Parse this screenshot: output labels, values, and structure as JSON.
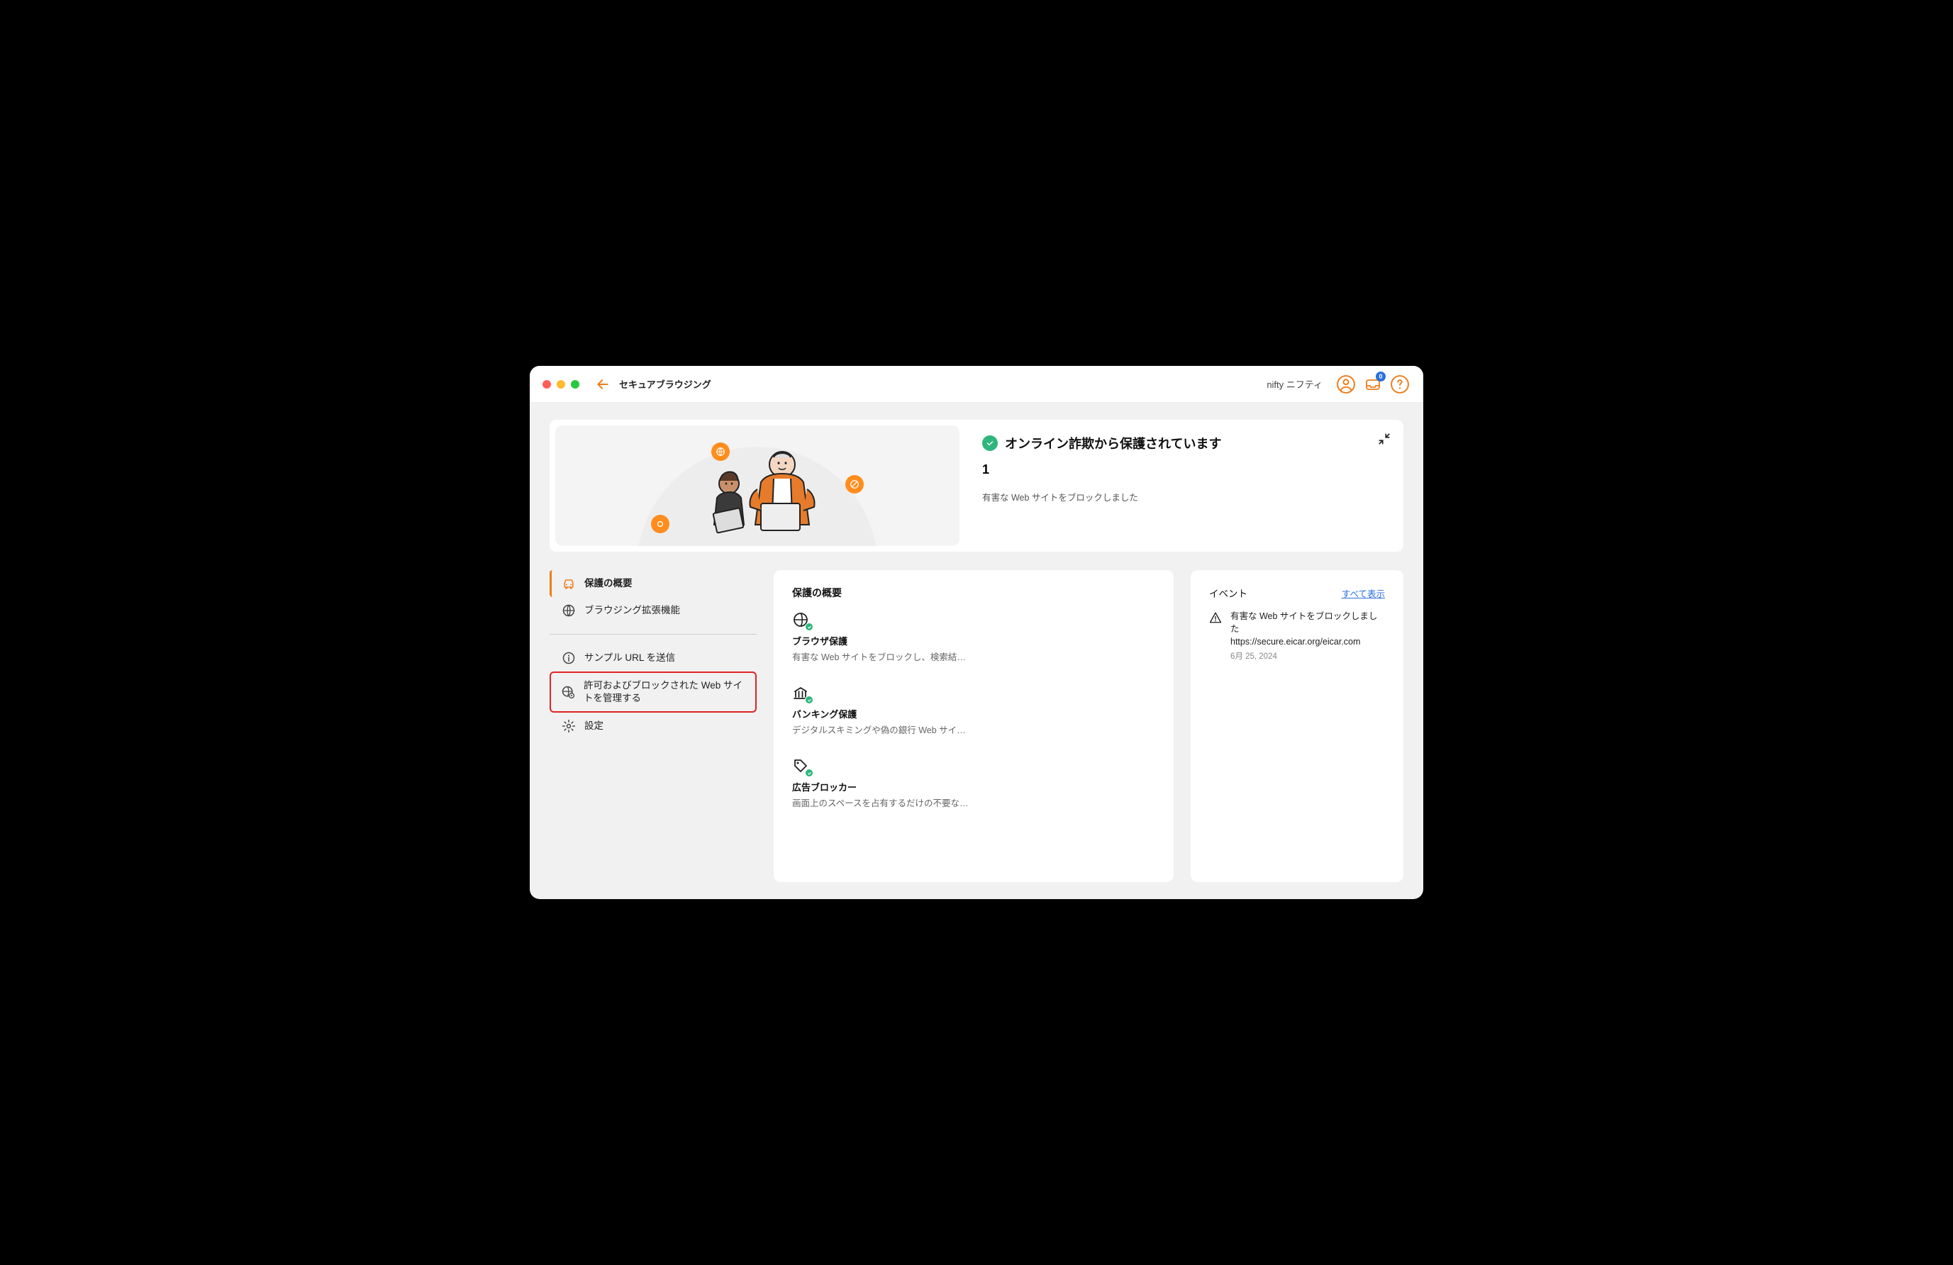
{
  "header": {
    "title": "セキュアブラウジング",
    "account": "nifty ニフティ",
    "notification_count": "0"
  },
  "hero": {
    "status_title": "オンライン詐欺から保護されています",
    "count": "1",
    "subtitle": "有害な Web サイトをブロックしました"
  },
  "sidebar": {
    "items": [
      {
        "label": "保護の概要"
      },
      {
        "label": "ブラウジング拡張機能"
      }
    ],
    "tools": [
      {
        "label": "サンプル URL を送信"
      },
      {
        "label": "許可およびブロックされた Web サイトを管理する"
      },
      {
        "label": "設定"
      }
    ]
  },
  "main": {
    "title": "保護の概要",
    "items": [
      {
        "name": "ブラウザ保護",
        "desc": "有害な Web サイトをブロックし、検索結果…"
      },
      {
        "name": "バンキング保護",
        "desc": "デジタルスキミングや偽の銀行 Web サイト…"
      },
      {
        "name": "広告ブロッカー",
        "desc": "画面上のスペースを占有するだけの不要な広…"
      }
    ]
  },
  "events": {
    "title": "イベント",
    "show_all": "すべて表示",
    "items": [
      {
        "line1": "有害な Web サイトをブロックしました",
        "line2": "https://secure.eicar.org/eicar.com",
        "date": "6月 25, 2024"
      }
    ]
  }
}
